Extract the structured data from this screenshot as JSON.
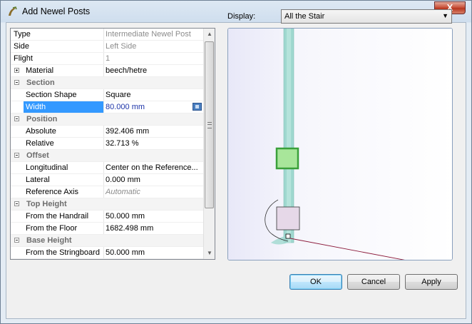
{
  "window": {
    "title": "Add Newel Posts"
  },
  "close_label": "X",
  "grid": {
    "rows": [
      {
        "kind": "prop",
        "name": "Type",
        "value": "Intermediate Newel Post",
        "style": "grey"
      },
      {
        "kind": "prop",
        "name": "Side",
        "value": "Left Side",
        "style": "grey"
      },
      {
        "kind": "prop",
        "name": "Flight",
        "value": "1",
        "style": "grey"
      },
      {
        "kind": "expandable",
        "name": "Material",
        "value": "beech/hetre"
      },
      {
        "kind": "category",
        "name": "Section"
      },
      {
        "kind": "prop",
        "name": "Section Shape",
        "value": "Square",
        "indent": true
      },
      {
        "kind": "prop",
        "name": "Width",
        "value": "80.000 mm",
        "indent": true,
        "selected": true
      },
      {
        "kind": "category",
        "name": "Position"
      },
      {
        "kind": "prop",
        "name": "Absolute",
        "value": "392.406 mm",
        "indent": true
      },
      {
        "kind": "prop",
        "name": "Relative",
        "value": "32.713 %",
        "indent": true
      },
      {
        "kind": "category",
        "name": "Offset"
      },
      {
        "kind": "prop",
        "name": "Longitudinal",
        "value": "Center on the Reference...",
        "indent": true
      },
      {
        "kind": "prop",
        "name": "Lateral",
        "value": "0.000 mm",
        "indent": true
      },
      {
        "kind": "prop",
        "name": "Reference Axis",
        "value": "Automatic",
        "indent": true,
        "style": "italic"
      },
      {
        "kind": "category",
        "name": "Top Height"
      },
      {
        "kind": "prop",
        "name": "From the Handrail",
        "value": "50.000 mm",
        "indent": true
      },
      {
        "kind": "prop",
        "name": "From the Floor",
        "value": "1682.498 mm",
        "indent": true
      },
      {
        "kind": "category",
        "name": "Base Height"
      },
      {
        "kind": "prop",
        "name": "From the Stringboard",
        "value": "50.000 mm",
        "indent": true
      }
    ]
  },
  "display": {
    "label": "Display:",
    "value": "All the Stair"
  },
  "buttons": {
    "ok": "OK",
    "cancel": "Cancel",
    "apply": "Apply"
  },
  "colors": {
    "selection": "#3399ff",
    "stringer": "#9fd8cf",
    "newel_post": "#a8e69a",
    "newel_border": "#3aa03a"
  }
}
